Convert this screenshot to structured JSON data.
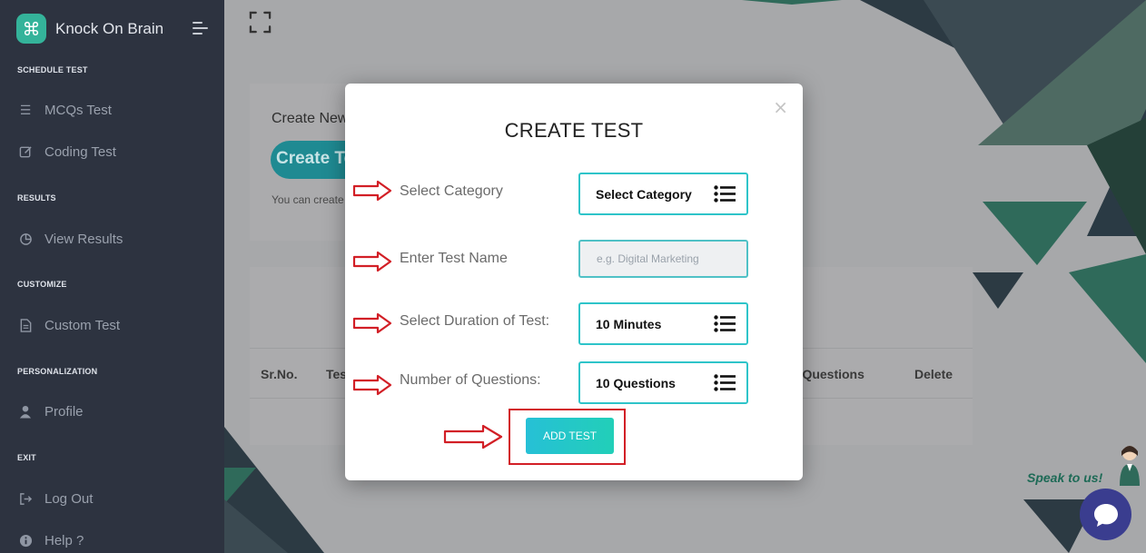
{
  "sidebar": {
    "brand": "Knock On Brain",
    "sections": [
      {
        "label": "SCHEDULE TEST"
      },
      {
        "label": "RESULTS"
      },
      {
        "label": "CUSTOMIZE"
      },
      {
        "label": "PERSONALIZATION"
      },
      {
        "label": "EXIT"
      }
    ],
    "items": [
      {
        "label": "MCQs Test",
        "icon": "list-icon"
      },
      {
        "label": "Coding Test",
        "icon": "edit-icon"
      },
      {
        "label": "View Results",
        "icon": "pie-chart-icon"
      },
      {
        "label": "Custom Test",
        "icon": "document-icon"
      },
      {
        "label": "Profile",
        "icon": "user-icon"
      },
      {
        "label": "Log Out",
        "icon": "logout-icon"
      },
      {
        "label": "Help ?",
        "icon": "info-icon"
      }
    ]
  },
  "main": {
    "create_card": {
      "title": "Create New",
      "button": "Create Test",
      "note": "You can create"
    },
    "table": {
      "headers": [
        "Sr.No.",
        "Test",
        "d Questions",
        "Delete"
      ]
    }
  },
  "modal": {
    "title": "CREATE TEST",
    "close": "×",
    "fields": [
      {
        "label": "Select Category",
        "value": "Select Category"
      },
      {
        "label": "Enter Test Name",
        "placeholder": "e.g. Digital Marketing"
      },
      {
        "label": "Select Duration of Test:",
        "value": "10 Minutes"
      },
      {
        "label": "Number of Questions:",
        "value": "10 Questions"
      }
    ],
    "submit": "ADD TEST"
  },
  "chat": {
    "speak_label": "Speak to us!"
  },
  "colors": {
    "sidebar_bg": "#2d3340",
    "accent_teal": "#2ec4c9",
    "annotation_red": "#d21f26",
    "brand_green": "#34b39a",
    "chat_bubble": "#3a3d8f"
  }
}
